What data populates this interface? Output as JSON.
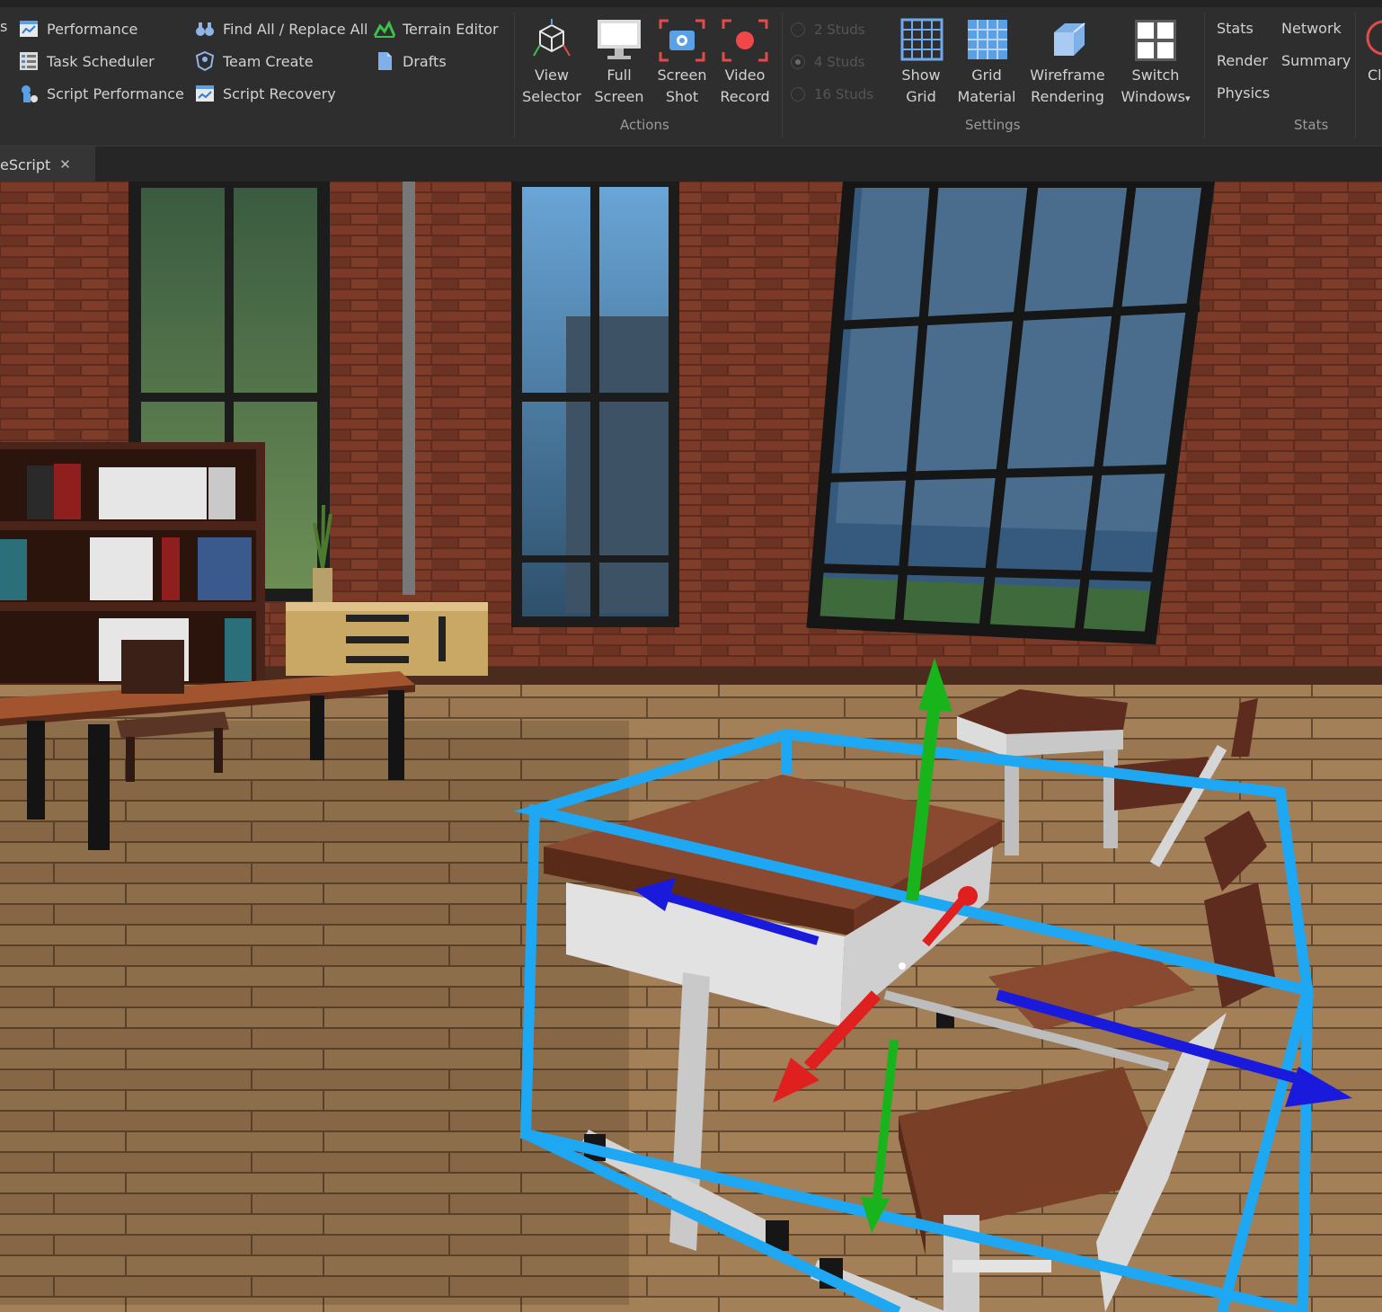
{
  "ribbon": {
    "col1": [
      {
        "label": "Performance",
        "icon": "performance-icon"
      },
      {
        "label": "Task Scheduler",
        "icon": "task-scheduler-icon"
      },
      {
        "label": "Script Performance",
        "icon": "script-performance-icon"
      }
    ],
    "col2": [
      {
        "label": "Find All / Replace All",
        "icon": "binoculars-icon"
      },
      {
        "label": "Team Create",
        "icon": "team-create-icon"
      },
      {
        "label": "Script Recovery",
        "icon": "script-recovery-icon"
      }
    ],
    "col3": [
      {
        "label": "Terrain Editor",
        "icon": "terrain-editor-icon"
      },
      {
        "label": "Drafts",
        "icon": "drafts-icon"
      }
    ],
    "partial_left": "s",
    "actions": {
      "view_selector": [
        "View",
        "Selector"
      ],
      "full_screen": [
        "Full",
        "Screen"
      ],
      "screen_shot": [
        "Screen",
        "Shot"
      ],
      "video_record": [
        "Video",
        "Record"
      ],
      "group_label": "Actions"
    },
    "grid_snap": [
      "2 Studs",
      "4 Studs",
      "16 Studs"
    ],
    "settings": {
      "show_grid": [
        "Show",
        "Grid"
      ],
      "grid_material": [
        "Grid",
        "Material"
      ],
      "wireframe": [
        "Wireframe",
        "Rendering"
      ],
      "switch_windows": [
        "Switch",
        "Windows"
      ],
      "group_label": "Settings"
    },
    "stats": {
      "stats": "Stats",
      "network": "Network",
      "render": "Render",
      "summary": "Summary",
      "physics": "Physics",
      "group_label": "Stats",
      "partial_right": "Cl"
    }
  },
  "tabs": [
    {
      "label": "eScript"
    }
  ],
  "colors": {
    "ribbon_bg": "#2e2e2e",
    "selection_box": "#1ea7f2",
    "axis_x": "#e01f1f",
    "axis_y": "#19b41c",
    "axis_z": "#1a1adc"
  }
}
